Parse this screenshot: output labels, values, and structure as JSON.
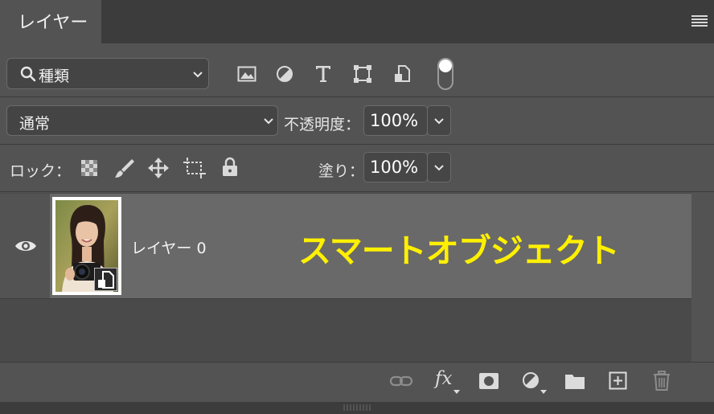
{
  "panel": {
    "tab_title": "レイヤー"
  },
  "filter": {
    "label": "種類",
    "icons": [
      "image-filter-icon",
      "adjustment-filter-icon",
      "type-filter-icon",
      "shape-filter-icon",
      "smart-object-filter-icon"
    ]
  },
  "blend": {
    "mode": "通常",
    "opacity_label": "不透明度：",
    "opacity_value": "100%"
  },
  "lock": {
    "label": "ロック：",
    "fill_label": "塗り：",
    "fill_value": "100%"
  },
  "layer": {
    "name": "レイヤー 0",
    "visible": true
  },
  "annotation": {
    "text": "スマートオブジェクト",
    "color": "#fff000"
  },
  "footer": {
    "icons": [
      "link-icon",
      "fx-icon",
      "mask-icon",
      "adjustment-icon",
      "folder-icon",
      "new-layer-icon",
      "trash-icon"
    ],
    "fx_label": "fx"
  }
}
